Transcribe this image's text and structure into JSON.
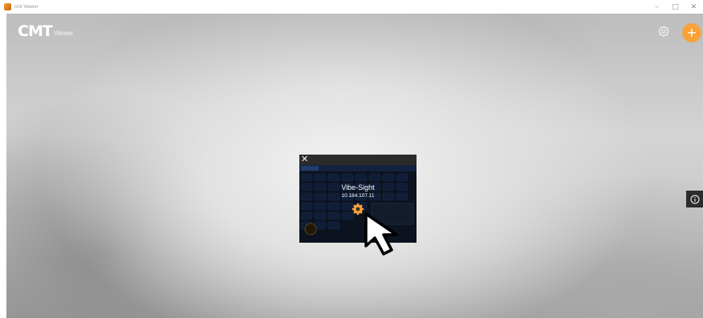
{
  "window": {
    "title": "cmt Viewer",
    "controls": {
      "minimize": "–",
      "maximize": "□",
      "close": "✕"
    }
  },
  "header": {
    "logo_main": "CMT",
    "logo_sub": "Viewer",
    "settings_icon": "gear-icon",
    "add_icon": "plus-icon",
    "add_label": "+"
  },
  "side": {
    "info_icon": "info-icon"
  },
  "tile": {
    "close_label": "✕",
    "name": "Vibe-Sight",
    "ip": "10.184.107.11",
    "settings_icon": "gear-icon"
  },
  "colors": {
    "accent": "#f7a23a",
    "tile_bg": "#1d2a3c",
    "thumb_cell": "#1a2f55"
  }
}
